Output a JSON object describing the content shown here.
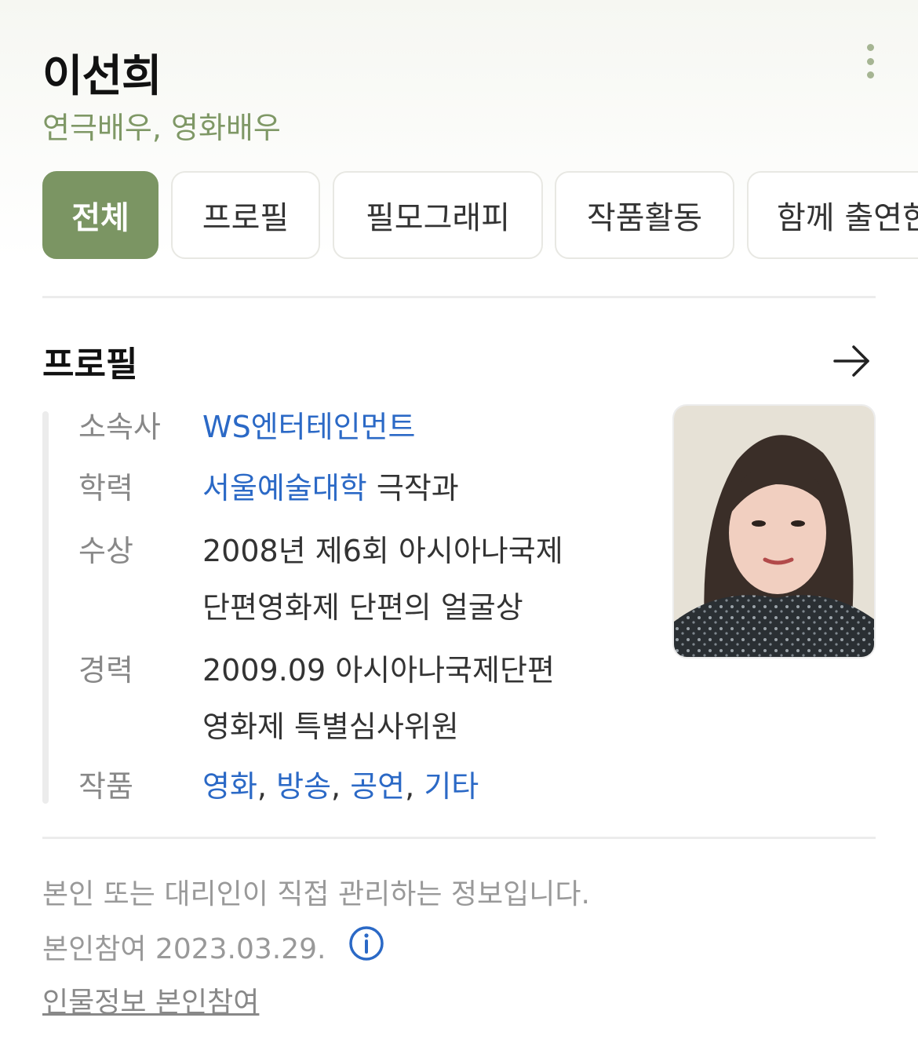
{
  "person": {
    "name": "이선희",
    "occupation": "연극배우, 영화배우"
  },
  "tabs": [
    {
      "label": "전체",
      "active": true
    },
    {
      "label": "프로필",
      "active": false
    },
    {
      "label": "필모그래피",
      "active": false
    },
    {
      "label": "작품활동",
      "active": false
    },
    {
      "label": "함께 출연한",
      "active": false
    }
  ],
  "profile": {
    "title": "프로필",
    "agency": {
      "label": "소속사",
      "value": "WS엔터테인먼트"
    },
    "education": {
      "label": "학력",
      "school": "서울예술대학",
      "dept": "극작과"
    },
    "award": {
      "label": "수상",
      "line1": "2008년 제6회 아시아나국제",
      "line2": "단편영화제 단편의 얼굴상"
    },
    "career": {
      "label": "경력",
      "line1": "2009.09 아시아나국제단편",
      "line2": "영화제 특별심사위원"
    },
    "works": {
      "label": "작품",
      "items": [
        "영화",
        "방송",
        "공연",
        "기타"
      ],
      "separator": ","
    }
  },
  "footer": {
    "notice": "본인 또는 대리인이 직접 관리하는 정보입니다.",
    "participation": "본인참여 2023.03.29.",
    "link": "인물정보 본인참여"
  },
  "colors": {
    "accent": "#7b9563",
    "link": "#2b69c6",
    "occupation": "#7f9866"
  },
  "icons": {
    "more": "vertical-dots-icon",
    "arrow": "arrow-right-icon",
    "info": "info-circle-icon"
  }
}
